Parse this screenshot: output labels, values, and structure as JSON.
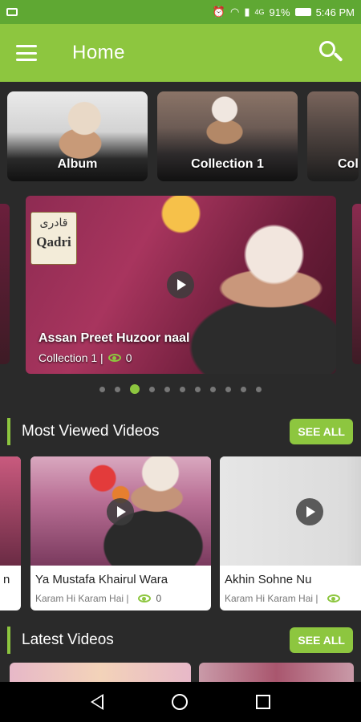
{
  "status_bar": {
    "time": "5:46 PM",
    "battery": "91%",
    "network": "4G"
  },
  "app_bar": {
    "title": "Home"
  },
  "categories": [
    {
      "label": "Album"
    },
    {
      "label": "Collection 1"
    },
    {
      "label": "Col"
    }
  ],
  "featured": {
    "title": "Assan Preet Huzoor naal",
    "collection": "Collection 1 |",
    "views": "0",
    "logo_text": "Qadri",
    "logo_urdu": "قادری",
    "dots_total": 11,
    "active_dot": 2
  },
  "most_viewed": {
    "heading": "Most Viewed Videos",
    "see_all": "SEE ALL",
    "peek_title": "n",
    "items": [
      {
        "title": "Ya Mustafa Khairul Wara",
        "album": "Karam Hi Karam Hai |",
        "views": "0"
      },
      {
        "title": "Akhin Sohne Nu",
        "album": "Karam Hi Karam Hai |",
        "views": ""
      }
    ]
  },
  "latest": {
    "heading": "Latest Videos",
    "see_all": "SEE ALL"
  },
  "colors": {
    "accent": "#8dc63f",
    "status": "#5fa833",
    "background": "#2a2a2a"
  }
}
